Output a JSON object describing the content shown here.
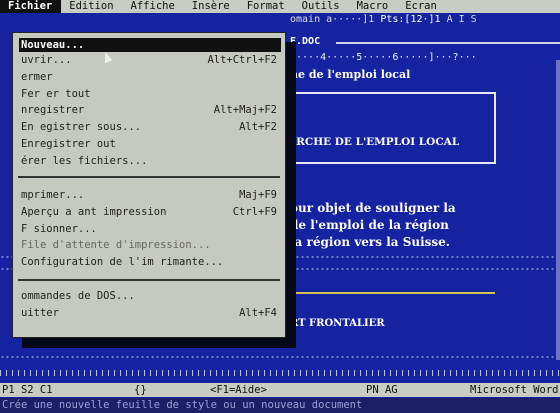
{
  "menubar": [
    "Fichier",
    "Edition",
    "Affiche",
    "Insère",
    "Format",
    "Outils",
    "Macro",
    "Ecran"
  ],
  "ruler": {
    "left": "omain a·····]1",
    "pts": "Pts:[12·]1",
    "flags": "A  I  S"
  },
  "doc_title": "E.DOC",
  "scale": "·····4·····5·····6·····]···?···",
  "document": {
    "line1": "he de l'emploi local",
    "line2": "ARCHE DE L'EMPLOI LOCAL",
    "para1": "our objet de souligner la",
    "para2": "  de l'emploi de la région",
    "para3": "la région vers la Suisse.",
    "heading2": "RT FRONTALIER"
  },
  "dropdown": {
    "items": [
      {
        "label": "Nouveau...",
        "key": ""
      },
      {
        "label": "uvrir...",
        "key": "Alt+Ctrl+F2"
      },
      {
        "label": "ermer",
        "key": ""
      },
      {
        "label": "Fer er tout",
        "key": ""
      },
      {
        "label": "nregistrer",
        "key": "Alt+Maj+F2"
      },
      {
        "label": "En egistrer sous...",
        "key": "Alt+F2"
      },
      {
        "label": "Enregistrer  out",
        "key": ""
      },
      {
        "label": "érer les fichiers...",
        "key": ""
      },
      {
        "label": "mprimer...",
        "key": "Maj+F9"
      },
      {
        "label": "Aperçu a ant impression",
        "key": "Ctrl+F9"
      },
      {
        "label": "F sionner...",
        "key": ""
      },
      {
        "label": "File d'attente d'impression...",
        "key": ""
      },
      {
        "label": "Configuration de l'im rimante...",
        "key": ""
      },
      {
        "label": "ommandes de DOS...",
        "key": ""
      },
      {
        "label": "uitter",
        "key": "Alt+F4"
      }
    ]
  },
  "status": {
    "pos": "P1 S2 C1",
    "braces": "{}",
    "help": "<F1=Aide>",
    "mode": "PN AG",
    "app": "Microsoft Word"
  },
  "hint": "Crée une nouvelle feuille de style ou un nouveau document"
}
